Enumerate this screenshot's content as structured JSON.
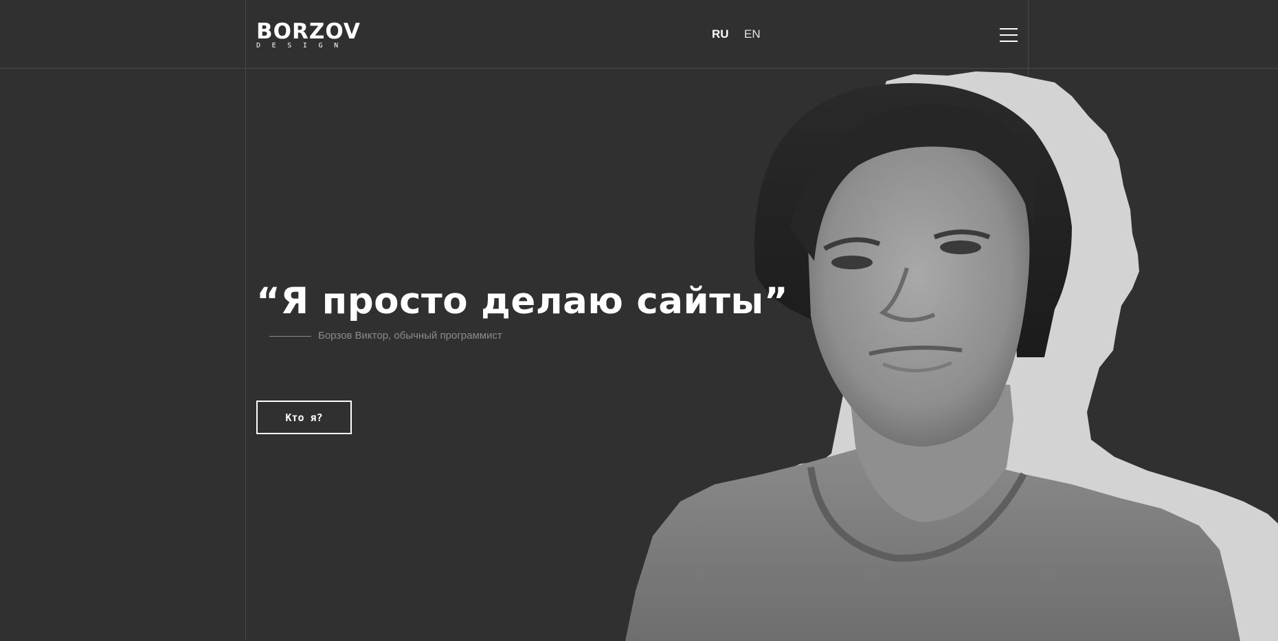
{
  "header": {
    "logo_main": "BORZOV",
    "logo_sub": "DESIGN",
    "lang_ru": "RU",
    "lang_en": "EN",
    "menu_icon": "hamburger-menu-icon"
  },
  "hero": {
    "quote": "“Я просто делаю сайты”",
    "signature": "Борзов Виктор, обычный программист",
    "cta_label": "Кто я?"
  },
  "portrait": {
    "description_icon": "portrait-photo"
  },
  "colors": {
    "background": "#303030",
    "grid_line": "#4a4a4a",
    "text": "#ffffff",
    "muted": "#8c8c8c",
    "paper": "#d3d3d3"
  }
}
